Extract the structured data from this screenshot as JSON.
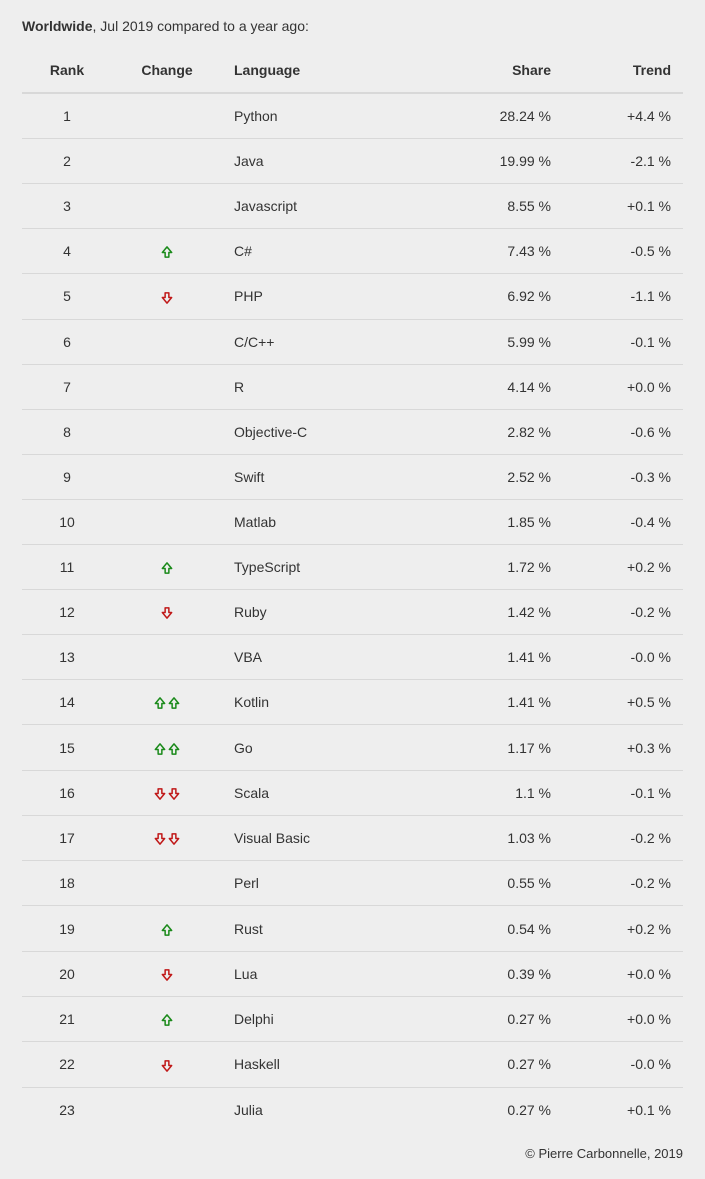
{
  "header": {
    "scope": "Worldwide",
    "period": ", Jul 2019 compared to a year ago:"
  },
  "columns": {
    "rank": "Rank",
    "change": "Change",
    "language": "Language",
    "share": "Share",
    "trend": "Trend"
  },
  "footer": "© Pierre Carbonnelle, 2019",
  "rows": [
    {
      "rank": 1,
      "change": "",
      "language": "Python",
      "share": "28.24 %",
      "trend": "+4.4 %"
    },
    {
      "rank": 2,
      "change": "",
      "language": "Java",
      "share": "19.99 %",
      "trend": "-2.1 %"
    },
    {
      "rank": 3,
      "change": "",
      "language": "Javascript",
      "share": "8.55 %",
      "trend": "+0.1 %"
    },
    {
      "rank": 4,
      "change": "up",
      "language": "C#",
      "share": "7.43 %",
      "trend": "-0.5 %"
    },
    {
      "rank": 5,
      "change": "down",
      "language": "PHP",
      "share": "6.92 %",
      "trend": "-1.1 %"
    },
    {
      "rank": 6,
      "change": "",
      "language": "C/C++",
      "share": "5.99 %",
      "trend": "-0.1 %"
    },
    {
      "rank": 7,
      "change": "",
      "language": "R",
      "share": "4.14 %",
      "trend": "+0.0 %"
    },
    {
      "rank": 8,
      "change": "",
      "language": "Objective-C",
      "share": "2.82 %",
      "trend": "-0.6 %"
    },
    {
      "rank": 9,
      "change": "",
      "language": "Swift",
      "share": "2.52 %",
      "trend": "-0.3 %"
    },
    {
      "rank": 10,
      "change": "",
      "language": "Matlab",
      "share": "1.85 %",
      "trend": "-0.4 %"
    },
    {
      "rank": 11,
      "change": "up",
      "language": "TypeScript",
      "share": "1.72 %",
      "trend": "+0.2 %"
    },
    {
      "rank": 12,
      "change": "down",
      "language": "Ruby",
      "share": "1.42 %",
      "trend": "-0.2 %"
    },
    {
      "rank": 13,
      "change": "",
      "language": "VBA",
      "share": "1.41 %",
      "trend": "-0.0 %"
    },
    {
      "rank": 14,
      "change": "up2",
      "language": "Kotlin",
      "share": "1.41 %",
      "trend": "+0.5 %"
    },
    {
      "rank": 15,
      "change": "up2",
      "language": "Go",
      "share": "1.17 %",
      "trend": "+0.3 %"
    },
    {
      "rank": 16,
      "change": "down2",
      "language": "Scala",
      "share": "1.1 %",
      "trend": "-0.1 %"
    },
    {
      "rank": 17,
      "change": "down2",
      "language": "Visual Basic",
      "share": "1.03 %",
      "trend": "-0.2 %"
    },
    {
      "rank": 18,
      "change": "",
      "language": "Perl",
      "share": "0.55 %",
      "trend": "-0.2 %"
    },
    {
      "rank": 19,
      "change": "up",
      "language": "Rust",
      "share": "0.54 %",
      "trend": "+0.2 %"
    },
    {
      "rank": 20,
      "change": "down",
      "language": "Lua",
      "share": "0.39 %",
      "trend": "+0.0 %"
    },
    {
      "rank": 21,
      "change": "up",
      "language": "Delphi",
      "share": "0.27 %",
      "trend": "+0.0 %"
    },
    {
      "rank": 22,
      "change": "down",
      "language": "Haskell",
      "share": "0.27 %",
      "trend": "-0.0 %"
    },
    {
      "rank": 23,
      "change": "",
      "language": "Julia",
      "share": "0.27 %",
      "trend": "+0.1 %"
    }
  ],
  "chart_data": {
    "type": "table",
    "title": "Worldwide, Jul 2019 compared to a year ago",
    "columns": [
      "Rank",
      "Change",
      "Language",
      "Share",
      "Trend"
    ],
    "rows": [
      [
        1,
        "",
        "Python",
        28.24,
        4.4
      ],
      [
        2,
        "",
        "Java",
        19.99,
        -2.1
      ],
      [
        3,
        "",
        "Javascript",
        8.55,
        0.1
      ],
      [
        4,
        "up",
        "C#",
        7.43,
        -0.5
      ],
      [
        5,
        "down",
        "PHP",
        6.92,
        -1.1
      ],
      [
        6,
        "",
        "C/C++",
        5.99,
        -0.1
      ],
      [
        7,
        "",
        "R",
        4.14,
        0.0
      ],
      [
        8,
        "",
        "Objective-C",
        2.82,
        -0.6
      ],
      [
        9,
        "",
        "Swift",
        2.52,
        -0.3
      ],
      [
        10,
        "",
        "Matlab",
        1.85,
        -0.4
      ],
      [
        11,
        "up",
        "TypeScript",
        1.72,
        0.2
      ],
      [
        12,
        "down",
        "Ruby",
        1.42,
        -0.2
      ],
      [
        13,
        "",
        "VBA",
        1.41,
        0.0
      ],
      [
        14,
        "up2",
        "Kotlin",
        1.41,
        0.5
      ],
      [
        15,
        "up2",
        "Go",
        1.17,
        0.3
      ],
      [
        16,
        "down2",
        "Scala",
        1.1,
        -0.1
      ],
      [
        17,
        "down2",
        "Visual Basic",
        1.03,
        -0.2
      ],
      [
        18,
        "",
        "Perl",
        0.55,
        -0.2
      ],
      [
        19,
        "up",
        "Rust",
        0.54,
        0.2
      ],
      [
        20,
        "down",
        "Lua",
        0.39,
        0.0
      ],
      [
        21,
        "up",
        "Delphi",
        0.27,
        0.0
      ],
      [
        22,
        "down",
        "Haskell",
        0.27,
        0.0
      ],
      [
        23,
        "",
        "Julia",
        0.27,
        0.1
      ]
    ]
  }
}
